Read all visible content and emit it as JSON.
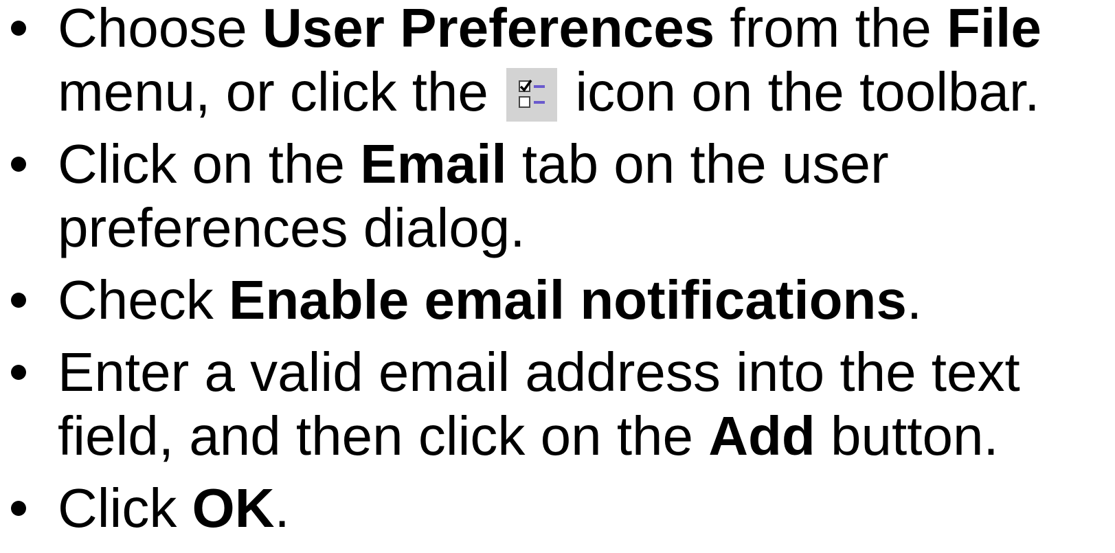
{
  "bullets": [
    {
      "lines": [
        [
          {
            "text": "Choose ",
            "bold": false
          },
          {
            "text": "User Preferences",
            "bold": true
          },
          {
            "text": " from the ",
            "bold": false
          },
          {
            "text": "File",
            "bold": true
          }
        ],
        [
          {
            "text": "menu, or click the ",
            "bold": false
          },
          {
            "icon": "user-preferences-icon"
          },
          {
            "text": " icon on the toolbar.",
            "bold": false
          }
        ]
      ]
    },
    {
      "lines": [
        [
          {
            "text": "Click on the ",
            "bold": false
          },
          {
            "text": "Email",
            "bold": true
          },
          {
            "text": " tab on the user",
            "bold": false
          }
        ],
        [
          {
            "text": "preferences dialog.",
            "bold": false
          }
        ]
      ]
    },
    {
      "lines": [
        [
          {
            "text": "Check ",
            "bold": false
          },
          {
            "text": "Enable email notifications",
            "bold": true
          },
          {
            "text": ".",
            "bold": false
          }
        ]
      ]
    },
    {
      "lines": [
        [
          {
            "text": "Enter a valid email address into the text",
            "bold": false
          }
        ],
        [
          {
            "text": "field, and then click on the ",
            "bold": false
          },
          {
            "text": "Add",
            "bold": true
          },
          {
            "text": " button.",
            "bold": false
          }
        ]
      ]
    },
    {
      "lines": [
        [
          {
            "text": "Click ",
            "bold": false
          },
          {
            "text": "OK",
            "bold": true
          },
          {
            "text": ".",
            "bold": false
          }
        ]
      ]
    }
  ],
  "colors": {
    "text": "#000000",
    "background": "#ffffff",
    "icon_background": "#d3d3d3",
    "icon_accent": "#6a5acd"
  }
}
